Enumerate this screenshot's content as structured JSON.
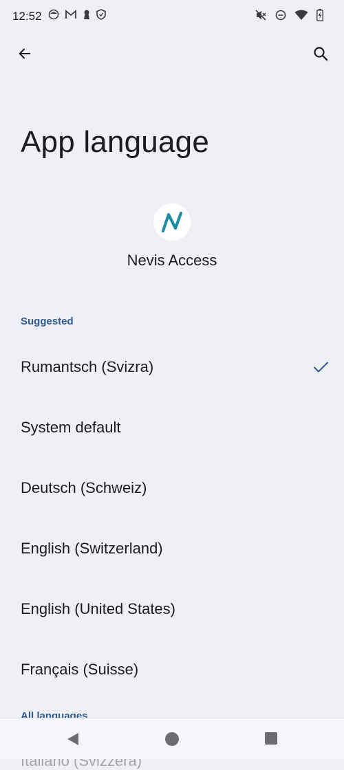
{
  "status_bar": {
    "time": "12:52",
    "left_icons": [
      "face-icon",
      "gmail-icon",
      "keyhole-icon",
      "shield-icon"
    ],
    "right_icons": [
      "vibrate-off-icon",
      "do-not-disturb-icon",
      "wifi-icon",
      "battery-icon"
    ]
  },
  "toolbar": {
    "back_icon": "arrow-back-icon",
    "search_icon": "search-icon"
  },
  "page": {
    "title": "App language"
  },
  "app": {
    "name": "Nevis Access",
    "logo_color": "#1f8fa5"
  },
  "sections": {
    "suggested": "Suggested",
    "all_languages": "All languages"
  },
  "languages": [
    {
      "label": "Rumantsch (Svizra)",
      "selected": true
    },
    {
      "label": "System default",
      "selected": false
    },
    {
      "label": "Deutsch (Schweiz)",
      "selected": false
    },
    {
      "label": "English (Switzerland)",
      "selected": false
    },
    {
      "label": "English (United States)",
      "selected": false
    },
    {
      "label": "Français (Suisse)",
      "selected": false
    }
  ],
  "peek_item": "Italiano (Svizzera)",
  "colors": {
    "background": "#eef0f6",
    "accent": "#2f5b8e",
    "text": "#1b1c20"
  }
}
